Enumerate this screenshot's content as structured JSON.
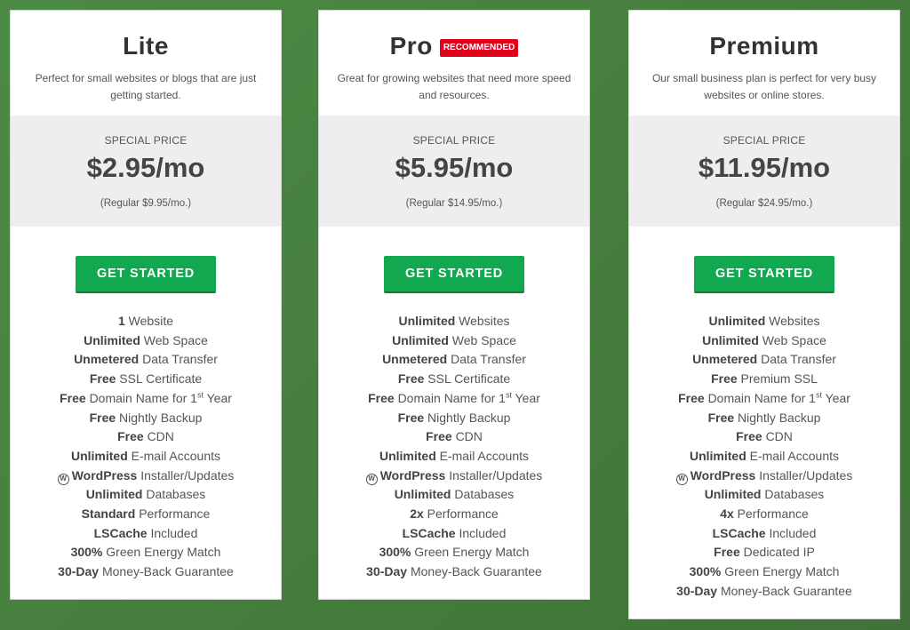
{
  "cta_label": "GET STARTED",
  "special_label": "SPECIAL PRICE",
  "colors": {
    "cta": "#11a84f",
    "badge": "#e3001b",
    "background": "#4d8a45",
    "price_box": "#eeeeee"
  },
  "plans": [
    {
      "name": "Lite",
      "badge": "",
      "description": "Perfect for small websites or blogs that are just getting started.",
      "price": "$2.95/mo",
      "regular": "(Regular $9.95/mo.)",
      "features": [
        {
          "bold": "1",
          "text": "Website"
        },
        {
          "bold": "Unlimited",
          "text": "Web Space"
        },
        {
          "bold": "Unmetered",
          "text": "Data Transfer"
        },
        {
          "bold": "Free",
          "text": "SSL Certificate"
        },
        {
          "bold": "Free",
          "text": "Domain Name for 1",
          "sup": "st",
          "after": "Year"
        },
        {
          "bold": "Free",
          "text": "Nightly Backup"
        },
        {
          "bold": "Free",
          "text": "CDN"
        },
        {
          "bold": "Unlimited",
          "text": "E-mail Accounts"
        },
        {
          "icon": "wordpress-icon",
          "bold": "WordPress",
          "text": "Installer/Updates"
        },
        {
          "bold": "Unlimited",
          "text": "Databases"
        },
        {
          "bold": "Standard",
          "text": "Performance"
        },
        {
          "bold": "LSCache",
          "text": "Included"
        },
        {
          "bold": "300%",
          "text": "Green Energy Match"
        },
        {
          "bold": "30-Day",
          "text": "Money-Back Guarantee"
        }
      ]
    },
    {
      "name": "Pro",
      "badge": "RECOMMENDED",
      "description": "Great for growing websites that need more speed and resources.",
      "price": "$5.95/mo",
      "regular": "(Regular $14.95/mo.)",
      "features": [
        {
          "bold": "Unlimited",
          "text": "Websites"
        },
        {
          "bold": "Unlimited",
          "text": "Web Space"
        },
        {
          "bold": "Unmetered",
          "text": "Data Transfer"
        },
        {
          "bold": "Free",
          "text": "SSL Certificate"
        },
        {
          "bold": "Free",
          "text": "Domain Name for 1",
          "sup": "st",
          "after": "Year"
        },
        {
          "bold": "Free",
          "text": "Nightly Backup"
        },
        {
          "bold": "Free",
          "text": "CDN"
        },
        {
          "bold": "Unlimited",
          "text": "E-mail Accounts"
        },
        {
          "icon": "wordpress-icon",
          "bold": "WordPress",
          "text": "Installer/Updates"
        },
        {
          "bold": "Unlimited",
          "text": "Databases"
        },
        {
          "bold": "2x",
          "text": "Performance"
        },
        {
          "bold": "LSCache",
          "text": "Included"
        },
        {
          "bold": "300%",
          "text": "Green Energy Match"
        },
        {
          "bold": "30-Day",
          "text": "Money-Back Guarantee"
        }
      ]
    },
    {
      "name": "Premium",
      "badge": "",
      "description": "Our small business plan is perfect for very busy websites or online stores.",
      "price": "$11.95/mo",
      "regular": "(Regular $24.95/mo.)",
      "features": [
        {
          "bold": "Unlimited",
          "text": "Websites"
        },
        {
          "bold": "Unlimited",
          "text": "Web Space"
        },
        {
          "bold": "Unmetered",
          "text": "Data Transfer"
        },
        {
          "bold": "Free",
          "text": "Premium SSL"
        },
        {
          "bold": "Free",
          "text": "Domain Name for 1",
          "sup": "st",
          "after": "Year"
        },
        {
          "bold": "Free",
          "text": "Nightly Backup"
        },
        {
          "bold": "Free",
          "text": "CDN"
        },
        {
          "bold": "Unlimited",
          "text": "E-mail Accounts"
        },
        {
          "icon": "wordpress-icon",
          "bold": "WordPress",
          "text": "Installer/Updates"
        },
        {
          "bold": "Unlimited",
          "text": "Databases"
        },
        {
          "bold": "4x",
          "text": "Performance"
        },
        {
          "bold": "LSCache",
          "text": "Included"
        },
        {
          "bold": "Free",
          "text": "Dedicated IP"
        },
        {
          "bold": "300%",
          "text": "Green Energy Match"
        },
        {
          "bold": "30-Day",
          "text": "Money-Back Guarantee"
        }
      ]
    }
  ]
}
